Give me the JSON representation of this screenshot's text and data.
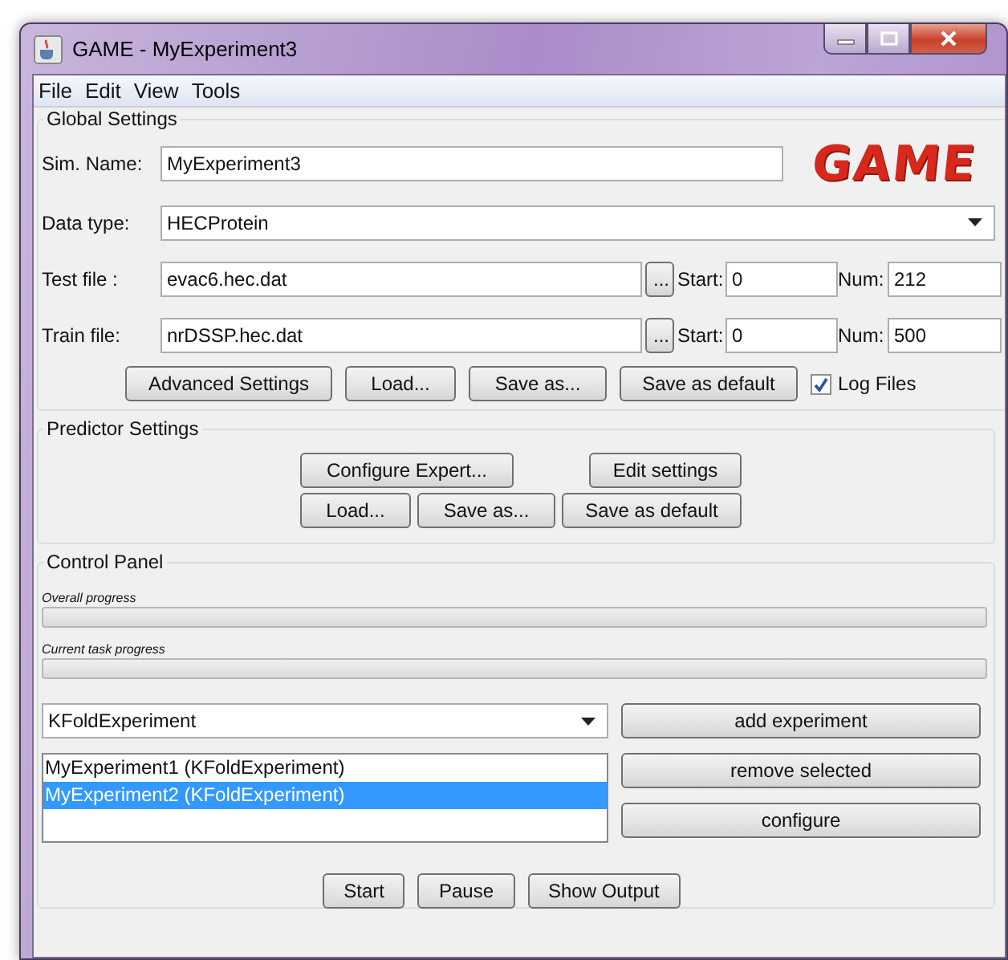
{
  "window": {
    "title": "GAME - MyExperiment3"
  },
  "menu": [
    "File",
    "Edit",
    "View",
    "Tools"
  ],
  "global_settings": {
    "title": "Global Settings",
    "logo": "GAME",
    "sim_name": {
      "label": "Sim. Name:",
      "value": "MyExperiment3"
    },
    "data_type": {
      "label": "Data type:",
      "value": "HECProtein"
    },
    "files": [
      {
        "label": "Test file :",
        "value": "evac6.hec.dat",
        "browse": "...",
        "start_label": "Start:",
        "start": "0",
        "num_label": "Num:",
        "num": "212"
      },
      {
        "label": "Train file:",
        "value": "nrDSSP.hec.dat",
        "browse": "...",
        "start_label": "Start:",
        "start": "0",
        "num_label": "Num:",
        "num": "500"
      }
    ],
    "buttons": [
      "Advanced Settings",
      "Load...",
      "Save as...",
      "Save as default"
    ],
    "log_files": {
      "label": "Log Files",
      "checked": true
    }
  },
  "predictor_settings": {
    "title": "Predictor Settings",
    "buttons": [
      [
        "Configure Expert...",
        "Edit settings"
      ],
      [
        "Load...",
        "Save as...",
        "Save as default"
      ]
    ]
  },
  "control_panel": {
    "title": "Control Panel",
    "progress": [
      {
        "label": "Overall progress",
        "level": 0
      },
      {
        "label": "Current task progress",
        "level": 0
      }
    ],
    "experiment_type": "KFoldExperiment",
    "experiments": [
      {
        "label": "MyExperiment1 (KFoldExperiment)",
        "selected": false
      },
      {
        "label": "MyExperiment2 (KFoldExperiment)",
        "selected": true
      }
    ],
    "side_buttons": [
      "add experiment",
      "remove selected",
      "configure"
    ],
    "buttons": [
      "Start",
      "Pause",
      "Show Output"
    ]
  }
}
